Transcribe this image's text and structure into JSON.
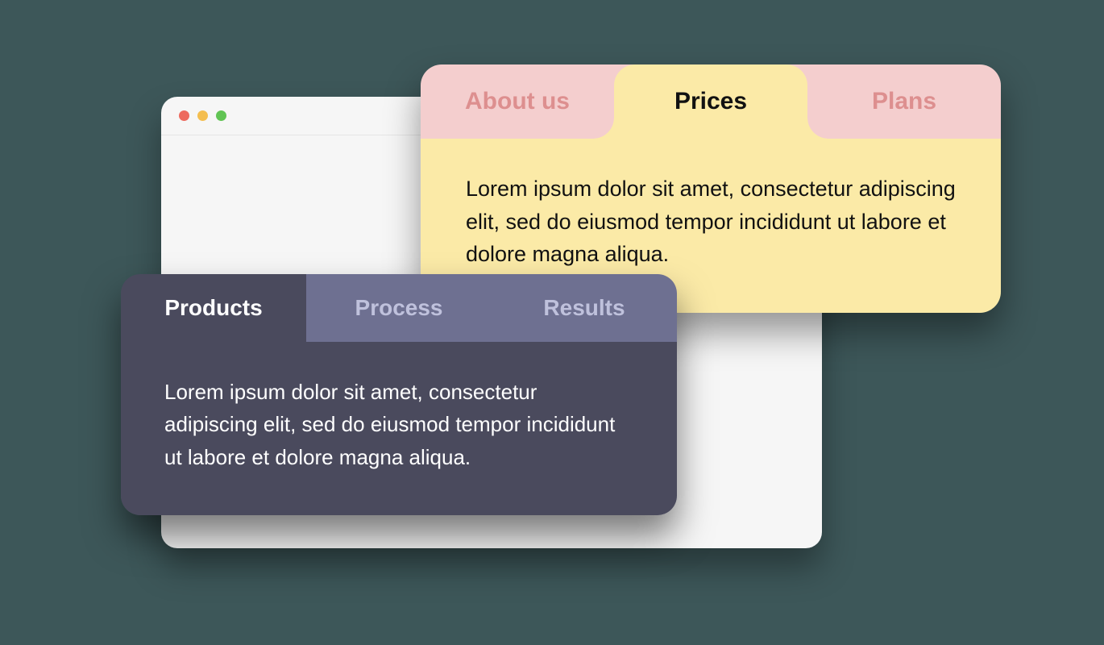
{
  "lightCard": {
    "tabs": [
      {
        "label": "About us",
        "active": false
      },
      {
        "label": "Prices",
        "active": true
      },
      {
        "label": "Plans",
        "active": false
      }
    ],
    "body": "Lorem ipsum dolor sit amet, consectetur adipiscing elit, sed do eiusmod tempor incididunt ut labore et dolore magna aliqua."
  },
  "darkCard": {
    "tabs": [
      {
        "label": "Products",
        "active": true
      },
      {
        "label": "Process",
        "active": false
      },
      {
        "label": "Results",
        "active": false
      }
    ],
    "body": "Lorem ipsum dolor sit amet, consectetur adipiscing elit, sed do eiusmod tempor incididunt ut labore et dolore magna aliqua."
  },
  "colors": {
    "pageBg": "#3d5759",
    "lightTabBar": "#f4cece",
    "lightTabInactiveText": "#dd8f8f",
    "lightActiveBg": "#fbeaa7",
    "darkTabInactiveBg": "#6e7091",
    "darkTabInactiveText": "#bfc1dc",
    "darkActiveBg": "#4a4a5d"
  }
}
